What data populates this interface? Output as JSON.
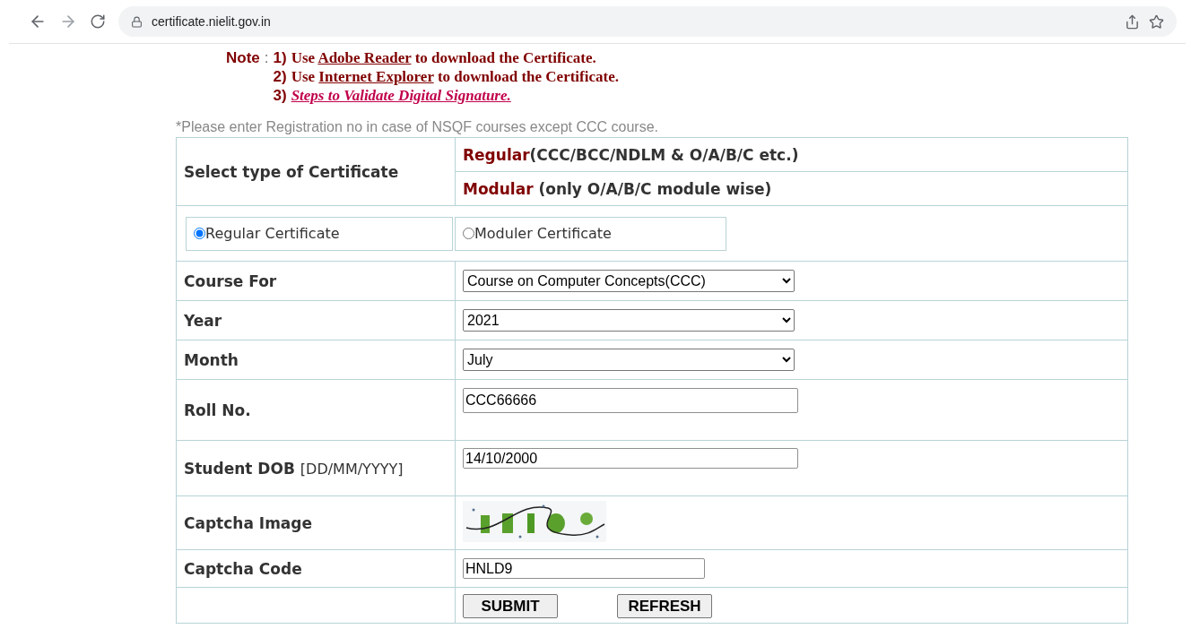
{
  "browser": {
    "url": "certificate.nielit.gov.in"
  },
  "note": {
    "label": "Note",
    "separator": ":",
    "items": [
      {
        "kind": "download",
        "number": "1)",
        "before": "Use ",
        "link": "Adobe Reader",
        "after": " to download the Certificate."
      },
      {
        "kind": "download",
        "number": "2)",
        "before": "Use ",
        "link": "Internet Explorer",
        "after": " to download the Certificate."
      },
      {
        "kind": "guide",
        "number": "3)",
        "link": "Steps to Validate Digital Signature."
      }
    ]
  },
  "hint": "*Please enter Registration no in case of NSQF courses except CCC course.",
  "certificate_type": {
    "label": "Select type of Certificate",
    "options": [
      {
        "name": "Regular",
        "detail": "(CCC/BCC/NDLM & O/A/B/C etc.)"
      },
      {
        "name": "Modular",
        "detail": "(only O/A/B/C module wise)"
      }
    ]
  },
  "radios": [
    {
      "label": "Regular Certificate",
      "selected": true
    },
    {
      "label": "Moduler Certificate",
      "selected": false
    }
  ],
  "fields": [
    {
      "kind": "select",
      "label": "Course For",
      "value": "Course on Computer Concepts(CCC)"
    },
    {
      "kind": "select",
      "label": "Year",
      "value": "2021"
    },
    {
      "kind": "select",
      "label": "Month",
      "value": "July"
    },
    {
      "kind": "text",
      "label": "Roll No.",
      "value": "CCC66666"
    },
    {
      "kind": "date",
      "label": "Student DOB",
      "format": "[DD/MM/YYYY]",
      "value": "14/10/2000"
    },
    {
      "kind": "captcha",
      "label": "Captcha Image"
    },
    {
      "kind": "code",
      "label": "Captcha Code",
      "value": "HNLD9"
    }
  ],
  "buttons": [
    "SUBMIT",
    "REFRESH"
  ]
}
